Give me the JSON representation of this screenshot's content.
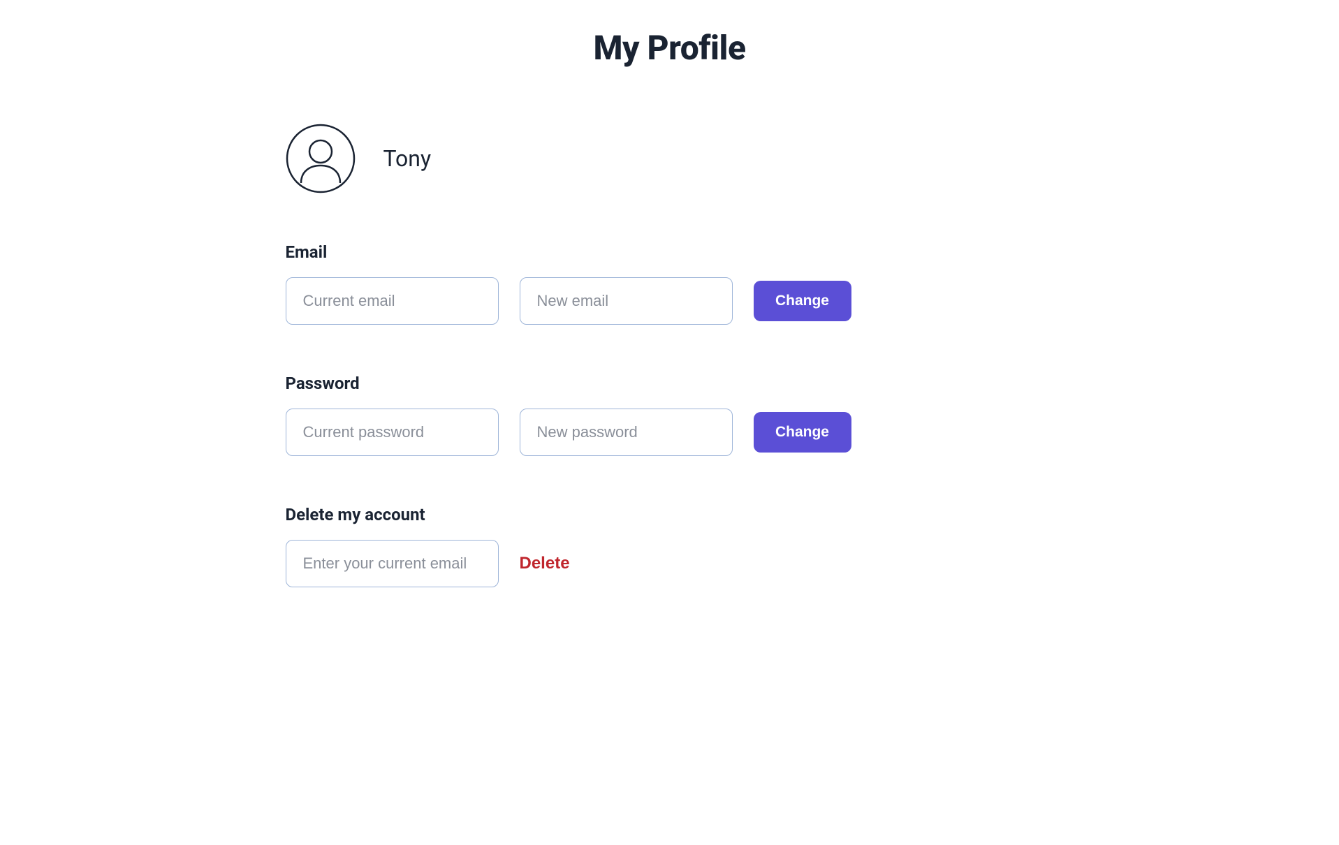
{
  "page": {
    "title": "My Profile"
  },
  "profile": {
    "username": "Tony"
  },
  "email_section": {
    "label": "Email",
    "current_placeholder": "Current email",
    "new_placeholder": "New email",
    "button_label": "Change"
  },
  "password_section": {
    "label": "Password",
    "current_placeholder": "Current password",
    "new_placeholder": "New password",
    "button_label": "Change"
  },
  "delete_section": {
    "label": "Delete my account",
    "input_placeholder": "Enter your current email",
    "button_label": "Delete"
  }
}
